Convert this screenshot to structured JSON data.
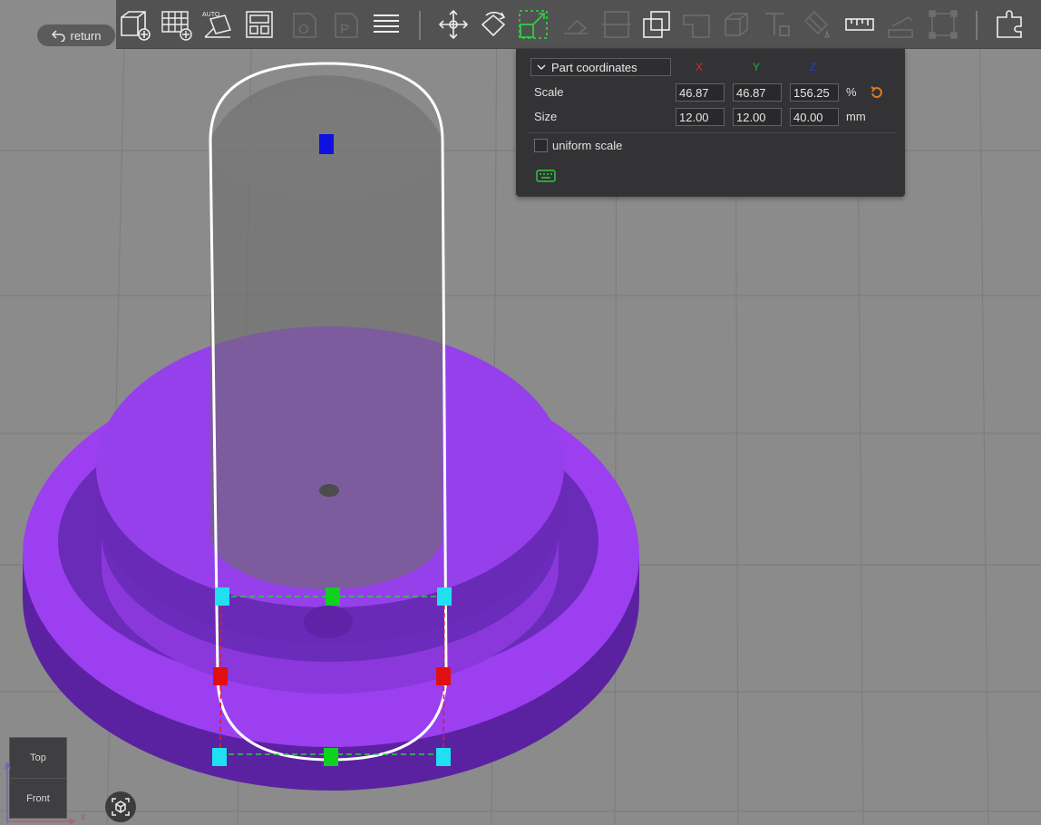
{
  "nav": {
    "return_label": "return"
  },
  "toolbar": {
    "tools": [
      {
        "name": "add-part-icon",
        "enabled": true
      },
      {
        "name": "add-grid-icon",
        "enabled": true
      },
      {
        "name": "auto-layout-icon",
        "enabled": true,
        "badge": "AUTO"
      },
      {
        "name": "layout-panels-icon",
        "enabled": true
      },
      {
        "name": "page-o-icon",
        "enabled": false
      },
      {
        "name": "page-p-icon",
        "enabled": false
      },
      {
        "name": "layers-icon",
        "enabled": true
      },
      {
        "name": "move-icon",
        "enabled": true
      },
      {
        "name": "rotate-icon",
        "enabled": true
      },
      {
        "name": "scale-icon",
        "enabled": true,
        "active": true
      },
      {
        "name": "lay-flat-icon",
        "enabled": false
      },
      {
        "name": "split-icon",
        "enabled": false
      },
      {
        "name": "boolean-icon",
        "enabled": true
      },
      {
        "name": "hollow-icon",
        "enabled": false
      },
      {
        "name": "shell-icon",
        "enabled": false
      },
      {
        "name": "text-tool-icon",
        "enabled": false
      },
      {
        "name": "paint-icon",
        "enabled": false
      },
      {
        "name": "measure-icon",
        "enabled": true
      },
      {
        "name": "cut-plane-icon",
        "enabled": false
      },
      {
        "name": "bounding-box-icon",
        "enabled": false
      },
      {
        "name": "plugins-icon",
        "enabled": true
      }
    ]
  },
  "panel": {
    "coordinate_mode": "Part coordinates",
    "axes": {
      "x": "X",
      "y": "Y",
      "z": "Z"
    },
    "axis_colors": {
      "x": "#d42a2a",
      "y": "#2aa84a",
      "z": "#2a3ad4"
    },
    "scale": {
      "label": "Scale",
      "x": "46.87",
      "y": "46.87",
      "z": "156.25",
      "unit": "%"
    },
    "size": {
      "label": "Size",
      "x": "12.00",
      "y": "12.00",
      "z": "40.00",
      "unit": "mm"
    },
    "uniform_scale": {
      "label": "uniform scale",
      "checked": false
    }
  },
  "view_cube": {
    "top": "Top",
    "front": "Front",
    "axis_x": "x",
    "axis_y": "y"
  },
  "colors": {
    "model": "#9b3ff0",
    "background": "#8b8b8b",
    "accent": "#e07a1f"
  }
}
